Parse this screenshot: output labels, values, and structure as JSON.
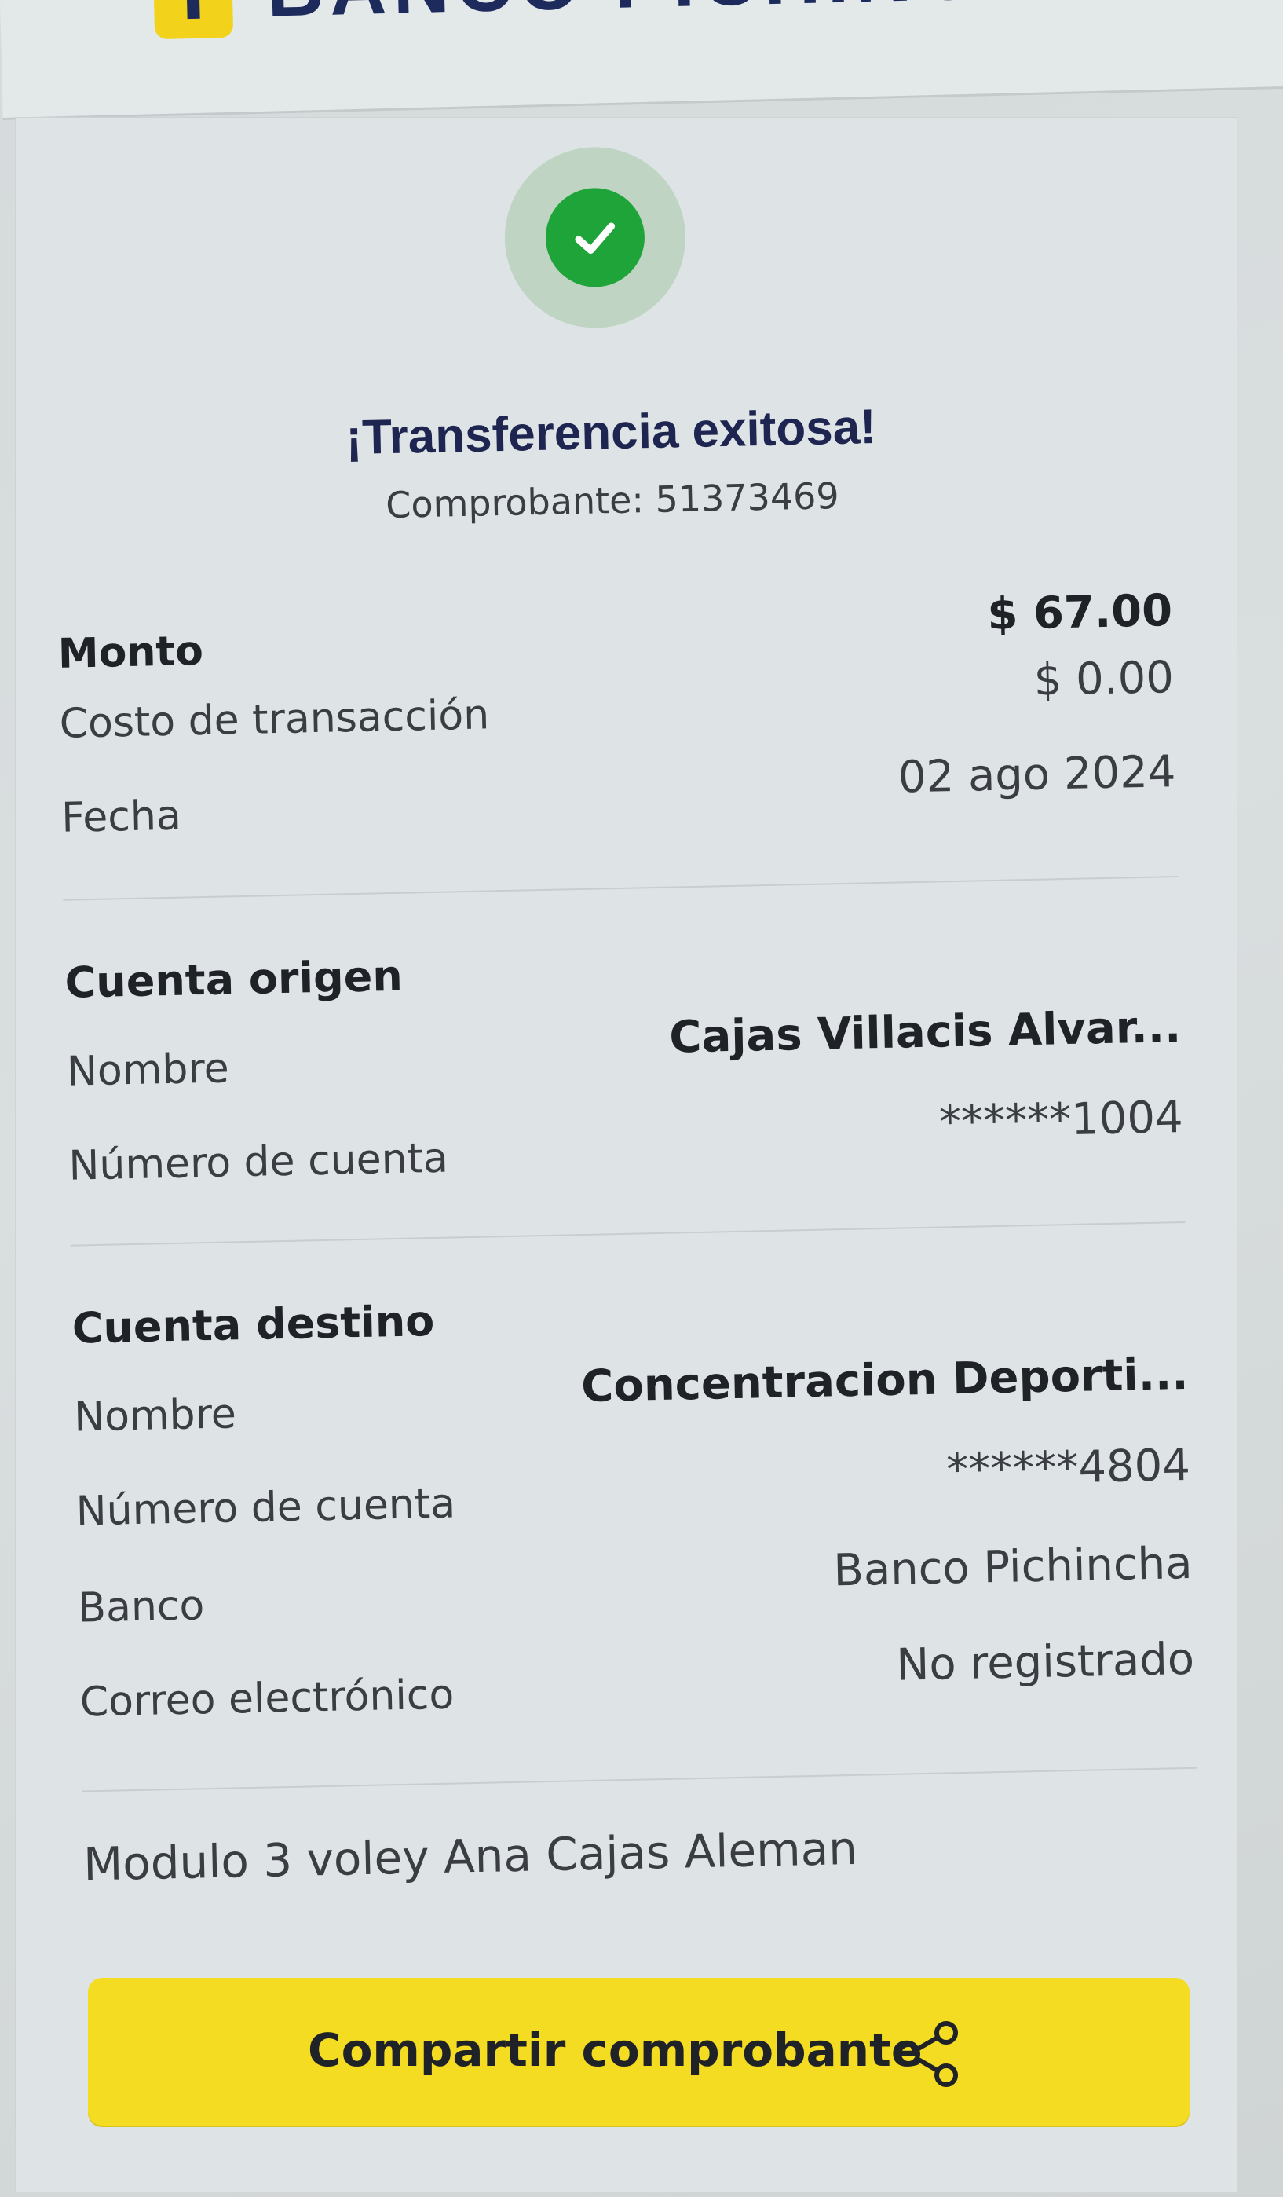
{
  "header": {
    "logo_text": "BANCO PICHINCHA"
  },
  "status": {
    "title": "¡Transferencia exitosa!",
    "receipt": "Comprobante: 51373469"
  },
  "summary": {
    "amount_label": "Monto",
    "amount_value": "$ 67.00",
    "fee_label": "Costo de transacción",
    "fee_value": "$ 0.00",
    "date_label": "Fecha",
    "date_value": "02 ago 2024"
  },
  "origin": {
    "title": "Cuenta origen",
    "name_label": "Nombre",
    "name_value": "Cajas  Villacis Alvar...",
    "account_label": "Número de cuenta",
    "account_value": "******1004"
  },
  "destination": {
    "title": "Cuenta destino",
    "name_label": "Nombre",
    "name_value": "Concentracion Deporti...",
    "account_label": "Número de cuenta",
    "account_value": "******4804",
    "bank_label": "Banco",
    "bank_value": "Banco Pichincha",
    "email_label": "Correo electrónico",
    "email_value": "No registrado"
  },
  "note": "Modulo 3 voley Ana Cajas Aleman",
  "actions": {
    "share_label": "Compartir comprobante",
    "share_icon": "share-icon"
  },
  "colors": {
    "success": "#1fa43a",
    "accent": "#f4dc22",
    "brand": "#1d2a5c"
  }
}
